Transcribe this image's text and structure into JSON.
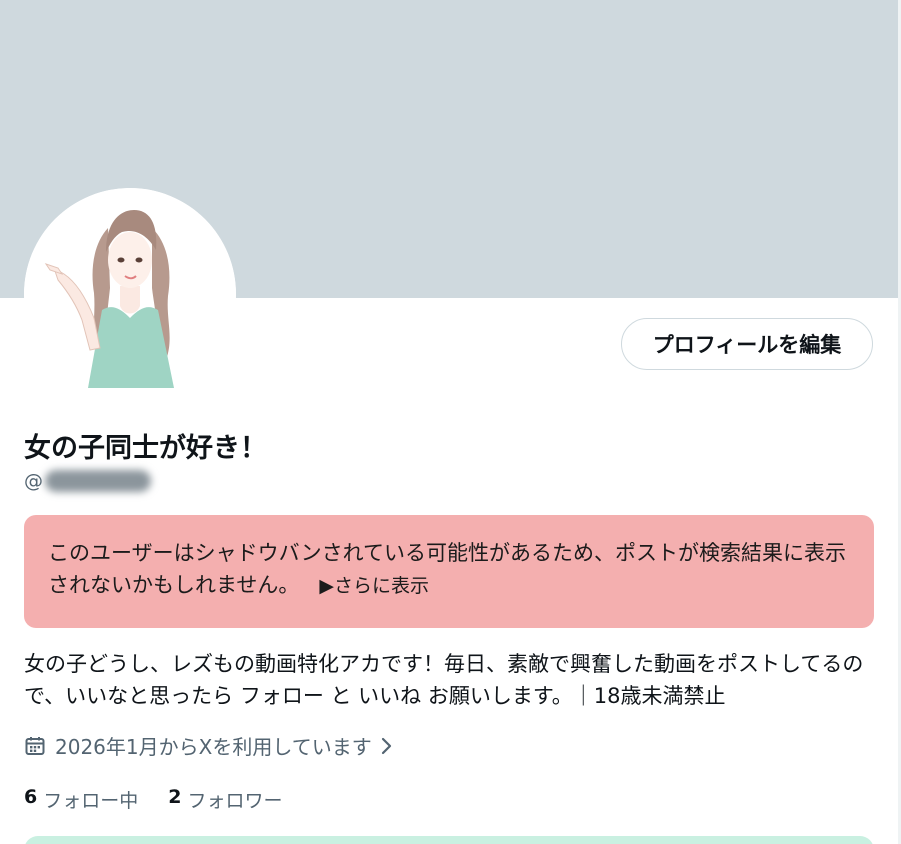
{
  "profile": {
    "display_name": "女の子同士が好き！",
    "handle_prefix": "@",
    "edit_button_label": "プロフィールを編集"
  },
  "warning": {
    "text": "このユーザーはシャドウバンされている可能性があるため、ポストが検索結果に表示されないかもしれません。",
    "more_label": "▶さらに表示"
  },
  "bio": {
    "text": "女の子どうし、レズもの動画特化アカです！毎日、素敵で興奮した動画をポストしてるので、いいなと思ったら フォロー と いいね お願いします。｜18歳未満禁止"
  },
  "joined": {
    "text": "2026年1月からXを利用しています",
    "icon": "calendar-icon"
  },
  "stats": {
    "following_count": "6",
    "following_label": "フォロー中",
    "followers_count": "2",
    "followers_label": "フォロワー"
  },
  "colors": {
    "banner": "#cfd9de",
    "warning_bg": "#f4afaf",
    "secondary_text": "#536471",
    "card_bg": "#c9f0e1"
  }
}
